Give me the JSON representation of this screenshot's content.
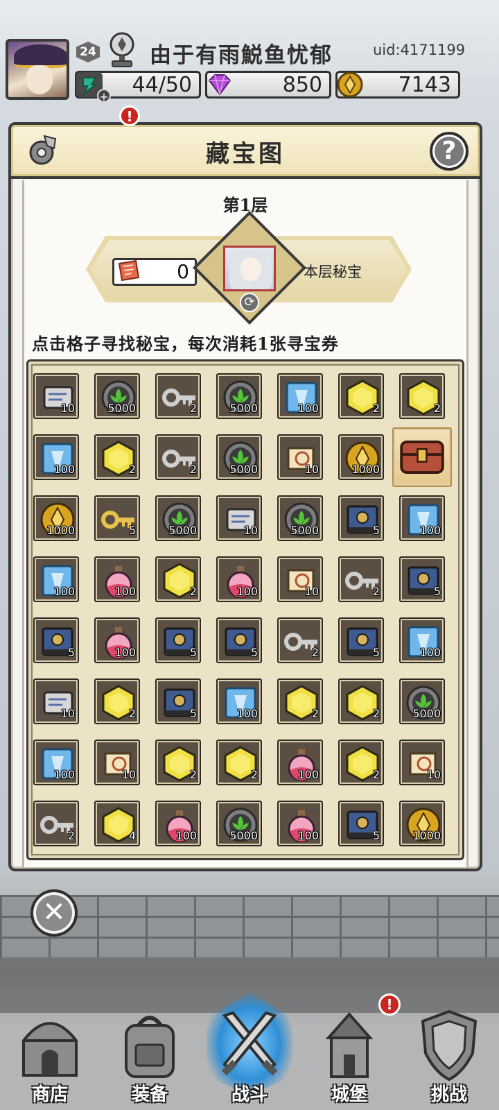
{
  "player": {
    "level": "24",
    "name": "由于有雨鮵鱼忧郁",
    "uid": "uid:4171199"
  },
  "resources": {
    "energy": "44/50",
    "gems": "850",
    "gold": "7143"
  },
  "panel": {
    "title": "藏宝图",
    "help_glyph": "?",
    "floor": "第1层",
    "tickets": "0",
    "secret_label": "本层秘宝",
    "instruction": "点击格子寻找秘宝，每次消耗1张寻宝券"
  },
  "grid": [
    [
      {
        "icon": "book",
        "q": "10"
      },
      {
        "icon": "leaf",
        "q": "5000"
      },
      {
        "icon": "key",
        "q": "2"
      },
      {
        "icon": "leaf",
        "q": "5000"
      },
      {
        "icon": "crystal",
        "q": "100"
      },
      {
        "icon": "hex",
        "q": "2"
      },
      {
        "icon": "hex",
        "q": "2"
      }
    ],
    [
      {
        "icon": "crystal",
        "q": "100"
      },
      {
        "icon": "hex",
        "q": "2"
      },
      {
        "icon": "key",
        "q": "2"
      },
      {
        "icon": "leaf",
        "q": "5000"
      },
      {
        "icon": "scroll",
        "q": "10"
      },
      {
        "icon": "coin",
        "q": "1000"
      },
      {
        "icon": "chest",
        "q": ""
      }
    ],
    [
      {
        "icon": "coin",
        "q": "1000"
      },
      {
        "icon": "goldkey",
        "q": "5"
      },
      {
        "icon": "leaf",
        "q": "5000"
      },
      {
        "icon": "book",
        "q": "10"
      },
      {
        "icon": "leaf",
        "q": "5000"
      },
      {
        "icon": "tome",
        "q": "5"
      },
      {
        "icon": "crystal",
        "q": "100"
      }
    ],
    [
      {
        "icon": "crystal",
        "q": "100"
      },
      {
        "icon": "potion",
        "q": "100"
      },
      {
        "icon": "hex",
        "q": "2"
      },
      {
        "icon": "potion",
        "q": "100"
      },
      {
        "icon": "scroll",
        "q": "10"
      },
      {
        "icon": "key",
        "q": "2"
      },
      {
        "icon": "tome",
        "q": "5"
      }
    ],
    [
      {
        "icon": "tome",
        "q": "5"
      },
      {
        "icon": "potion",
        "q": "100"
      },
      {
        "icon": "tome",
        "q": "5"
      },
      {
        "icon": "tome",
        "q": "5"
      },
      {
        "icon": "key",
        "q": "2"
      },
      {
        "icon": "tome",
        "q": "5"
      },
      {
        "icon": "crystal",
        "q": "100"
      }
    ],
    [
      {
        "icon": "book",
        "q": "10"
      },
      {
        "icon": "hex",
        "q": "2"
      },
      {
        "icon": "tome",
        "q": "5"
      },
      {
        "icon": "crystal",
        "q": "100"
      },
      {
        "icon": "hex",
        "q": "2"
      },
      {
        "icon": "hex",
        "q": "2"
      },
      {
        "icon": "leaf",
        "q": "5000"
      }
    ],
    [
      {
        "icon": "crystal",
        "q": "100"
      },
      {
        "icon": "scroll",
        "q": "10"
      },
      {
        "icon": "hex",
        "q": "2"
      },
      {
        "icon": "hex",
        "q": "2"
      },
      {
        "icon": "potion",
        "q": "100"
      },
      {
        "icon": "hex",
        "q": "2"
      },
      {
        "icon": "scroll",
        "q": "10"
      }
    ],
    [
      {
        "icon": "key",
        "q": "2"
      },
      {
        "icon": "hex",
        "q": "4"
      },
      {
        "icon": "potion",
        "q": "100"
      },
      {
        "icon": "leaf",
        "q": "5000"
      },
      {
        "icon": "potion",
        "q": "100"
      },
      {
        "icon": "tome",
        "q": "5"
      },
      {
        "icon": "coin",
        "q": "1000"
      }
    ]
  ],
  "close_glyph": "✕",
  "nav": {
    "shop": "商店",
    "equipment": "装备",
    "battle": "战斗",
    "castle": "城堡",
    "challenge": "挑战",
    "alert_glyph": "!"
  }
}
